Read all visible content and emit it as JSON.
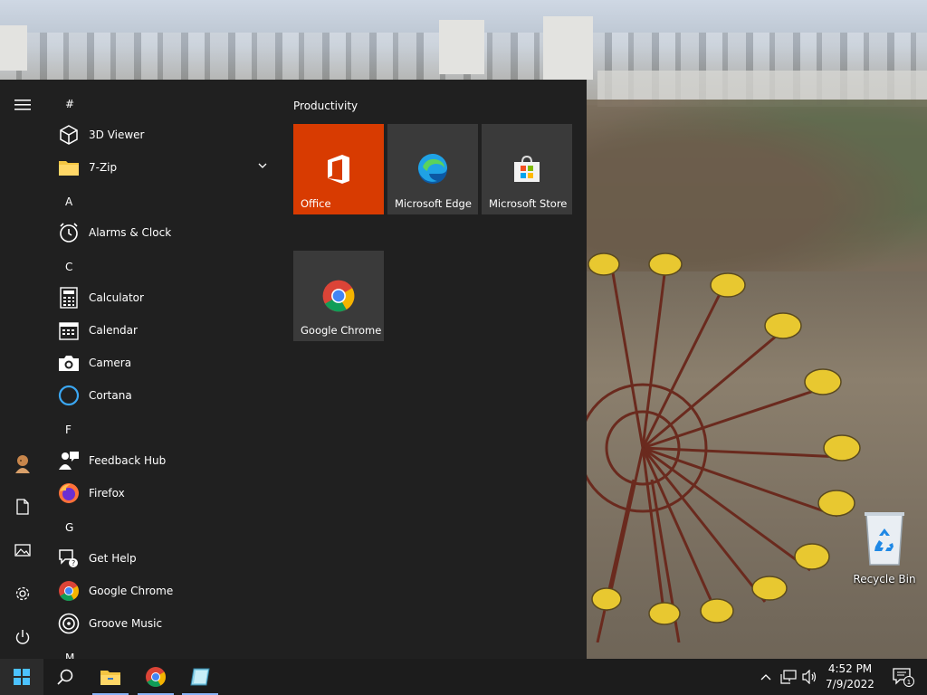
{
  "start_menu": {
    "rail": {
      "menu_icon": "hamburger-icon",
      "user_icon": "user-avatar-icon",
      "documents_icon": "document-icon",
      "pictures_icon": "pictures-icon",
      "settings_icon": "gear-icon",
      "power_icon": "power-icon"
    },
    "app_list": {
      "headers": {
        "hash": "#",
        "a": "A",
        "c": "C",
        "f": "F",
        "g": "G",
        "m": "M"
      },
      "apps": {
        "viewer3d": "3D Viewer",
        "zip7": "7-Zip",
        "alarms": "Alarms & Clock",
        "calculator": "Calculator",
        "calendar": "Calendar",
        "camera": "Camera",
        "cortana": "Cortana",
        "feedback": "Feedback Hub",
        "firefox": "Firefox",
        "gethelp": "Get Help",
        "chrome": "Google Chrome",
        "groove": "Groove Music"
      }
    },
    "tiles": {
      "group_title": "Productivity",
      "office": "Office",
      "edge": "Microsoft Edge",
      "store": "Microsoft Store",
      "chrome": "Google Chrome"
    }
  },
  "desktop": {
    "recycle_bin": "Recycle Bin"
  },
  "taskbar": {
    "time": "4:52 PM",
    "date": "7/9/2022",
    "notification_count": "1"
  },
  "colors": {
    "start_bg": "#202020",
    "taskbar_bg": "#1c1c1c",
    "office_tile": "#d83b01",
    "tile_bg": "#3a3a3a",
    "start_button": "#4cc2ff"
  }
}
